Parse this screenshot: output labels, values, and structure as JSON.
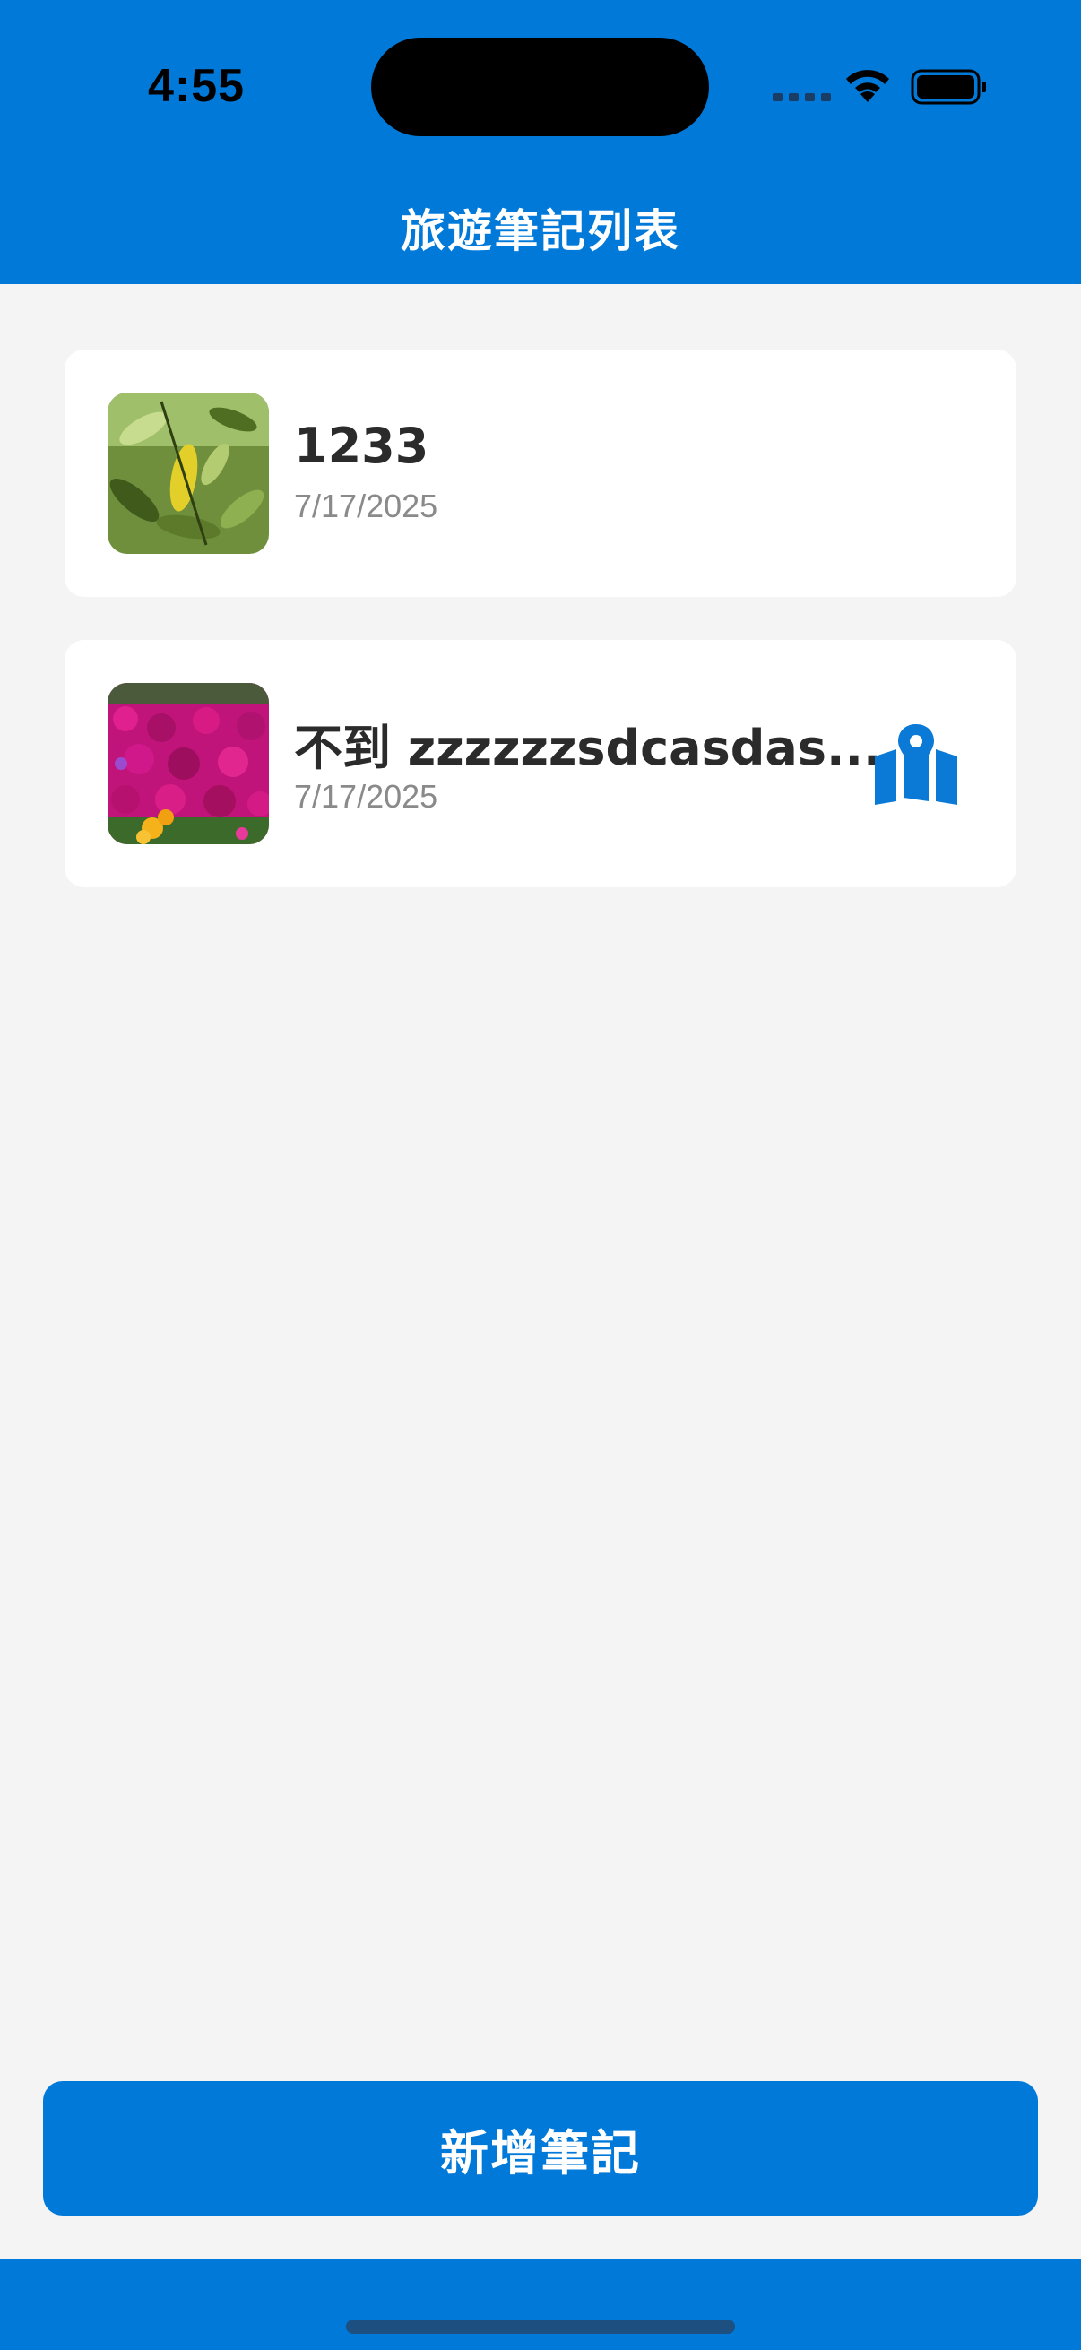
{
  "status_bar": {
    "time": "4:55"
  },
  "header": {
    "title": "旅遊筆記列表"
  },
  "notes": [
    {
      "title": "1233",
      "date": "7/17/2025",
      "thumbnail": "leaves-photo",
      "has_map": false
    },
    {
      "title": "不到 zzzzzzsdcasdas...",
      "date": "7/17/2025",
      "thumbnail": "flowers-photo",
      "has_map": true
    }
  ],
  "actions": {
    "add_label": "新增筆記"
  },
  "icons": {
    "map": "map-pin-icon"
  },
  "colors": {
    "primary": "#0079d9",
    "background": "#f4f4f5",
    "card": "#ffffff",
    "title": "#2b2b2b",
    "date": "#8a8a8a"
  }
}
